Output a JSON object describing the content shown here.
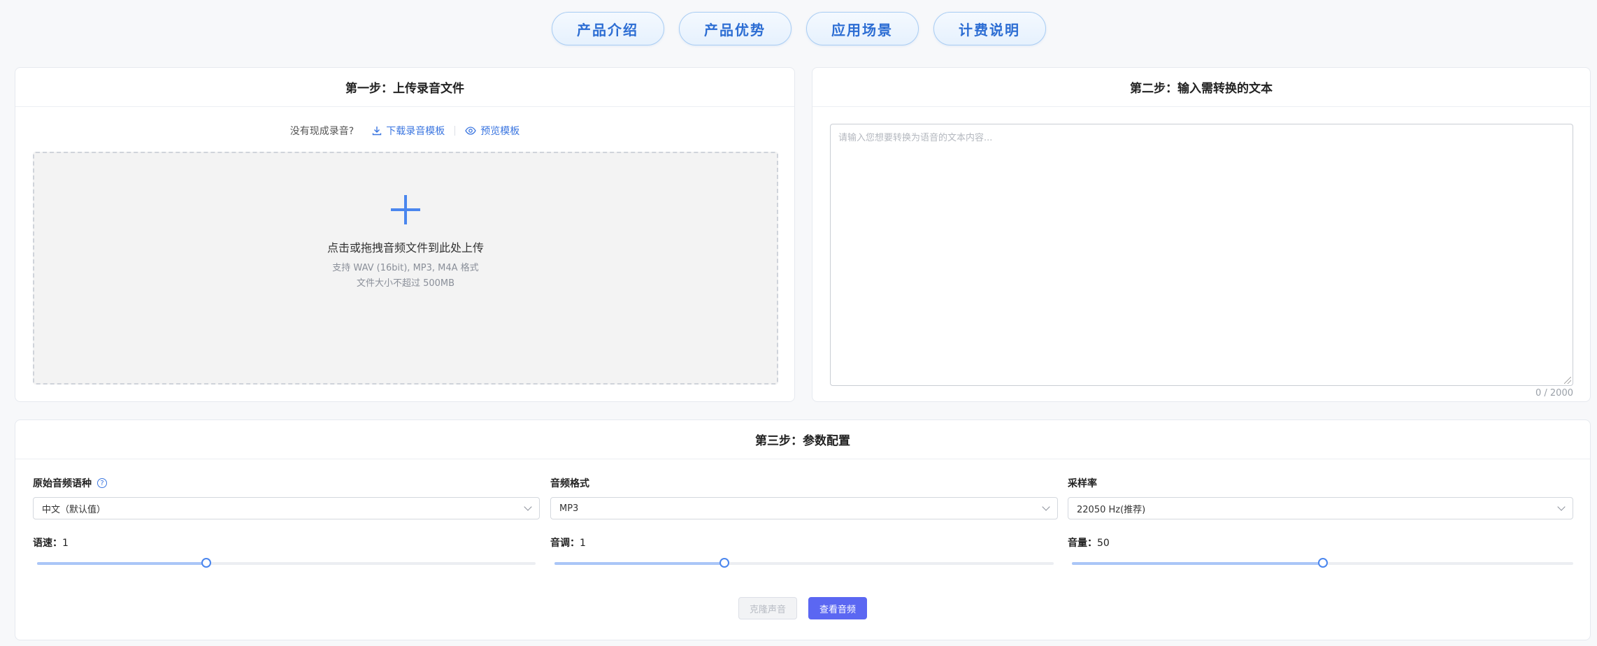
{
  "nav": {
    "items": [
      "产品介绍",
      "产品优势",
      "应用场景",
      "计费说明"
    ]
  },
  "step1": {
    "title": "第一步：上传录音文件",
    "no_recording": "没有现成录音?",
    "download_template": "下载录音模板",
    "preview_template": "预览模板",
    "dropzone_title": "点击或拖拽音频文件到此处上传",
    "dropzone_formats": "支持 WAV (16bit), MP3, M4A 格式",
    "dropzone_size": "文件大小不超过 500MB"
  },
  "step2": {
    "title": "第二步：输入需转换的文本",
    "placeholder": "请输入您想要转换为语音的文本内容...",
    "char_count": "0 / 2000"
  },
  "step3": {
    "title": "第三步：参数配置",
    "language": {
      "label": "原始音频语种",
      "help": "?",
      "value": "中文（默认值）"
    },
    "format": {
      "label": "音频格式",
      "value": "MP3"
    },
    "sample_rate": {
      "label": "采样率",
      "value": "22050 Hz(推荐)"
    },
    "speed": {
      "label": "语速：",
      "value": "1",
      "level": 0.34
    },
    "pitch": {
      "label": "音调：",
      "value": "1",
      "level": 0.34
    },
    "volume": {
      "label": "音量：",
      "value": "50",
      "level": 0.5
    },
    "clone_button": "克隆声音",
    "view_button": "查看音频"
  },
  "colors": {
    "accent": "#3b76e0",
    "primary_button": "#5b67f2",
    "pill_text": "#2c6dd3"
  }
}
